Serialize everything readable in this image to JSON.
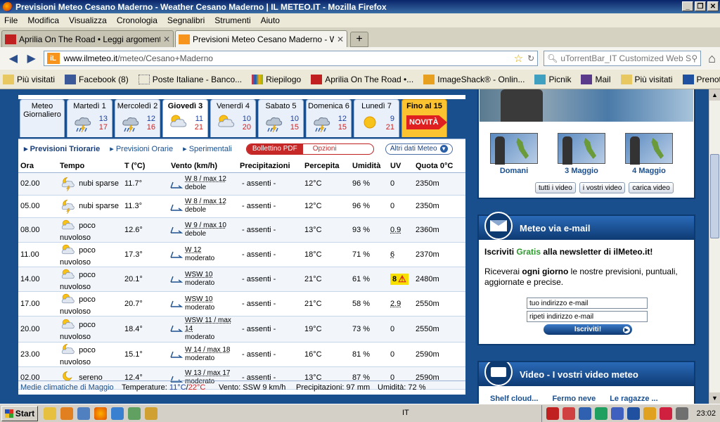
{
  "window": {
    "title": "Previsioni Meteo Cesano Maderno - Weather Cesano Maderno | IL METEO.IT - Mozilla Firefox"
  },
  "menu": [
    "File",
    "Modifica",
    "Visualizza",
    "Cronologia",
    "Segnalibri",
    "Strumenti",
    "Aiuto"
  ],
  "tabs": [
    {
      "label": "Aprilia On The Road • Leggi argomento - ..."
    },
    {
      "label": "Previsioni Meteo Cesano Maderno - Weat..."
    }
  ],
  "nav": {
    "url_host": "www.ilmeteo.it",
    "url_path": "/meteo/Cesano+Maderno",
    "search_placeholder": "uTorrentBar_IT Customized Web Se"
  },
  "bookmarks": [
    "Più visitati",
    "Facebook (8)",
    "Poste Italiane - Banco...",
    "Riepilogo",
    "Aprilia On The Road •...",
    "ImageShack® - Onlin...",
    "Picnik",
    "Mail",
    "Più visitati",
    "Prenotazione traghet..."
  ],
  "days": [
    {
      "name": "Meteo",
      "sub": "Giornaliero"
    },
    {
      "name": "Martedì 1",
      "min": "13",
      "max": "17",
      "icon": "rain-storm"
    },
    {
      "name": "Mercoledì 2",
      "min": "12",
      "max": "16",
      "icon": "rain-storm"
    },
    {
      "name": "Giovedì 3",
      "min": "11",
      "max": "21",
      "icon": "sun-cloud",
      "active": true
    },
    {
      "name": "Venerdì 4",
      "min": "10",
      "max": "20",
      "icon": "sun-cloud"
    },
    {
      "name": "Sabato 5",
      "min": "10",
      "max": "15",
      "icon": "rain-storm"
    },
    {
      "name": "Domenica 6",
      "min": "12",
      "max": "15",
      "icon": "rain-storm"
    },
    {
      "name": "Lunedì 7",
      "min": "9",
      "max": "21",
      "icon": "sun"
    },
    {
      "name": "Fino al 15",
      "badge": "NOVITÀ"
    }
  ],
  "submenu": {
    "items": [
      "Previsioni Triorarie",
      "Previsioni Orarie",
      "Sperimentali"
    ],
    "pdf": "Bollettino PDF",
    "options": "Opzioni",
    "altri": "Altri dati Meteo"
  },
  "table": {
    "headers": [
      "Ora",
      "Tempo",
      "T (°C)",
      "Vento (km/h)",
      "Precipitazioni",
      "Percepita",
      "Umidità",
      "UV",
      "Quota 0°C"
    ],
    "rows": [
      {
        "ora": "02.00",
        "icon": "moon-storm",
        "tempo": "nubi sparse",
        "t": "11.7°",
        "w1": "W 8 / max 12",
        "w2": "debole",
        "prec": "- assenti -",
        "perc": "12°C",
        "umid": "96 %",
        "uv": "0",
        "quota": "2350m"
      },
      {
        "ora": "05.00",
        "icon": "moon-storm",
        "tempo": "nubi sparse",
        "t": "11.3°",
        "w1": "W 8 / max 12",
        "w2": "debole",
        "prec": "- assenti -",
        "perc": "12°C",
        "umid": "96 %",
        "uv": "0",
        "quota": "2350m"
      },
      {
        "ora": "08.00",
        "icon": "sun-cloud",
        "tempo": "poco nuvoloso",
        "t": "12.6°",
        "w1": "W 9 / max 10",
        "w2": "debole",
        "prec": "- assenti -",
        "perc": "13°C",
        "umid": "93 %",
        "uv": "0.9",
        "quota": "2360m"
      },
      {
        "ora": "11.00",
        "icon": "sun-cloud",
        "tempo": "poco nuvoloso",
        "t": "17.3°",
        "w1": "W 12",
        "w2": "moderato",
        "prec": "- assenti -",
        "perc": "18°C",
        "umid": "71 %",
        "uv": "6",
        "quota": "2370m"
      },
      {
        "ora": "14.00",
        "icon": "sun-cloud",
        "tempo": "poco nuvoloso",
        "t": "20.1°",
        "w1": "WSW 10",
        "w2": "moderato",
        "prec": "- assenti -",
        "perc": "21°C",
        "umid": "61 %",
        "uv": "8",
        "quota": "2480m"
      },
      {
        "ora": "17.00",
        "icon": "sun-cloud",
        "tempo": "poco nuvoloso",
        "t": "20.7°",
        "w1": "WSW 10",
        "w2": "moderato",
        "prec": "- assenti -",
        "perc": "21°C",
        "umid": "58 %",
        "uv": "2.9",
        "quota": "2550m"
      },
      {
        "ora": "20.00",
        "icon": "sun-cloud",
        "tempo": "poco nuvoloso",
        "t": "18.4°",
        "w1": "WSW 11 / max 14",
        "w2": "moderato",
        "prec": "- assenti -",
        "perc": "19°C",
        "umid": "73 %",
        "uv": "0",
        "quota": "2550m"
      },
      {
        "ora": "23.00",
        "icon": "moon-cloud",
        "tempo": "poco nuvoloso",
        "t": "15.1°",
        "w1": "W 14 / max 18",
        "w2": "moderato",
        "prec": "- assenti -",
        "perc": "16°C",
        "umid": "81 %",
        "uv": "0",
        "quota": "2590m"
      },
      {
        "ora": "02.00",
        "icon": "moon",
        "tempo": "sereno",
        "t": "12.4°",
        "w1": "W 13 / max 17",
        "w2": "moderato",
        "prec": "- assenti -",
        "perc": "13°C",
        "umid": "87 %",
        "uv": "0",
        "quota": "2590m"
      }
    ]
  },
  "footer": {
    "medie": "Medie climatiche di Maggio",
    "temp_label": "Temperature:",
    "temp_min": "11°C",
    "sep": "/",
    "temp_max": "22°C",
    "vento_label": "Vento:",
    "vento": "SSW 9 km/h",
    "prec_label": "Precipitazioni:",
    "prec": "97 mm",
    "umid_label": "Umidità:",
    "umid": "72 %"
  },
  "right": {
    "thumbs": [
      "Domani",
      "3 Maggio",
      "4 Maggio"
    ],
    "video_buttons": [
      "tutti i video",
      "i vostri video",
      "carica video"
    ],
    "email_title": "Meteo via e-mail",
    "email_l1a": "Iscriviti ",
    "email_l1b": "Gratis",
    "email_l1c": " alla newsletter di ilMeteo.it!",
    "email_l2a": "Riceverai ",
    "email_l2b": "ogni giorno",
    "email_l2c": " le nostre previsioni, puntuali, aggiornate e precise.",
    "email_input1": "tuo indirizzo e-mail",
    "email_input2": "ripeti indirizzo e-mail",
    "subscribe": "Iscriviti!",
    "video2_title": "Video - I vostri video meteo",
    "video2_items": [
      "Shelf cloud...",
      "Fermo neve",
      "Le ragazze ..."
    ]
  },
  "taskbar": {
    "start": "Start",
    "lang": "IT",
    "clock": "23:02"
  }
}
